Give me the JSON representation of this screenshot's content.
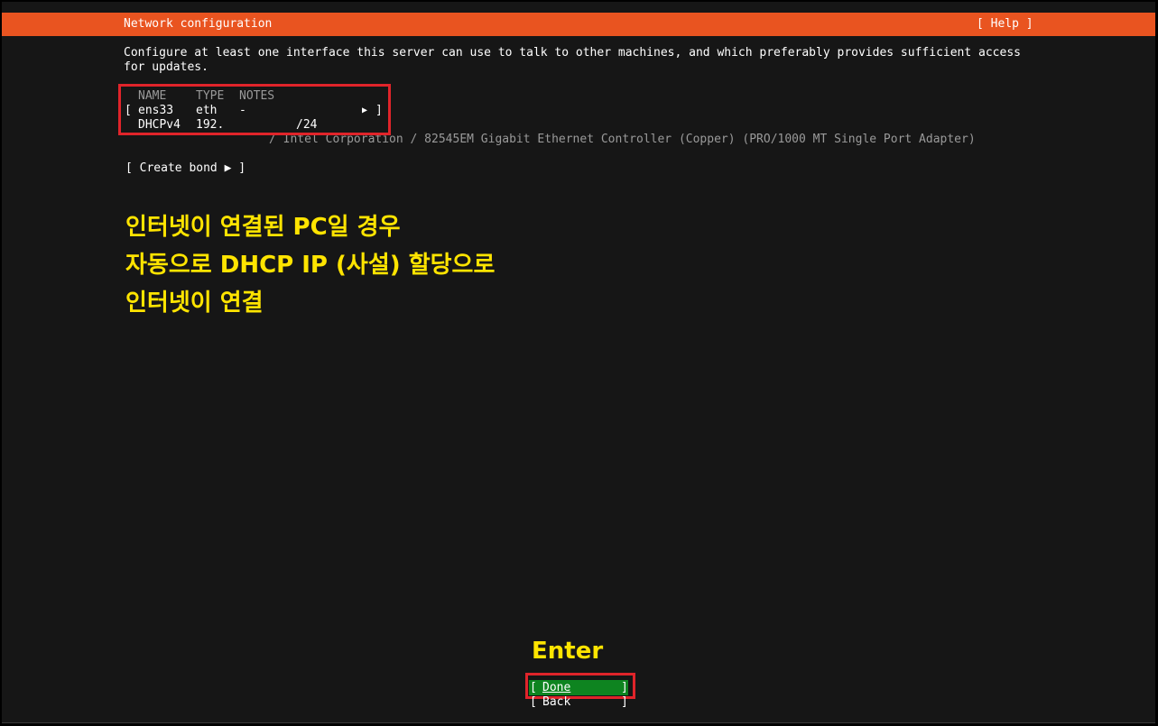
{
  "header": {
    "title": "Network configuration",
    "help_label": "[ Help ]",
    "color": "#e95420"
  },
  "description": "Configure at least one interface this server can use to talk to other machines, and which preferably provides sufficient access for updates.",
  "interfaces_table": {
    "columns": [
      "NAME",
      "TYPE",
      "NOTES"
    ],
    "rows": [
      {
        "name": "ens33",
        "type": "eth",
        "notes": "-",
        "bracket_open": "[",
        "arrow": "▶",
        "bracket_close": "]"
      }
    ],
    "address": {
      "method": "DHCPv4",
      "ip_prefix": "192.",
      "ip_suffix": "/24"
    },
    "device_description": "/ Intel Corporation / 82545EM Gigabit Ethernet Controller (Copper) (PRO/1000 MT Single Port Adapter)"
  },
  "create_bond": {
    "label": "[ Create bond ▶ ]"
  },
  "annotation": {
    "lines": [
      "인터넷이 연결된 PC일 경우",
      "자동으로 DHCP IP (사설) 할당으로",
      "인터넷이 연결"
    ],
    "enter_label": "Enter",
    "text_color": "#ffe400",
    "box_color": "#e0242a"
  },
  "buttons": {
    "done": {
      "bracket_open": "[",
      "label": "Done",
      "bracket_close": "]",
      "color": "#0e8420"
    },
    "back": {
      "bracket_open": "[",
      "label": "Back",
      "bracket_close": "]"
    }
  }
}
